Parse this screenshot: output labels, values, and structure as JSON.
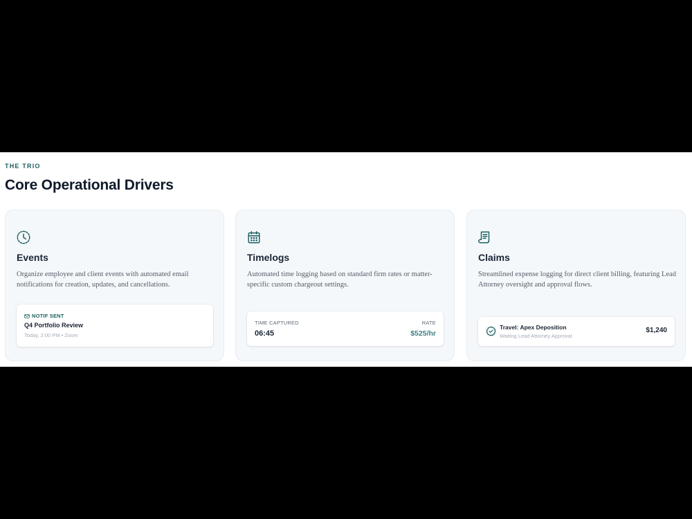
{
  "section": {
    "eyebrow": "THE TRIO",
    "title": "Core Operational Drivers"
  },
  "colors": {
    "accent": "#1a5e5e",
    "rate": "#3e7f84",
    "heading": "#0f1a2a",
    "card_bg": "#f5f8fb"
  },
  "cards": [
    {
      "icon": "clock-icon",
      "title": "Events",
      "description": "Organize employee and client events with automated email notifications for creation, updates, and cancellations.",
      "widget": {
        "tag_icon": "mail-icon",
        "tag": "NOTIF SENT",
        "title": "Q4 Portfolio Review",
        "meta": "Today, 2:00 PM • Zoom"
      }
    },
    {
      "icon": "calendar-icon",
      "title": "Timelogs",
      "description": "Automated time logging based on standard firm rates or matter-specific custom chargeout settings.",
      "widget": {
        "left_label": "TIME CAPTURED",
        "left_value": "06:45",
        "right_label": "RATE",
        "right_value": "$525/hr"
      }
    },
    {
      "icon": "receipt-icon",
      "title": "Claims",
      "description": "Streamlined expense logging for direct client billing, featuring Lead Attorney oversight and approval flows.",
      "widget": {
        "status_icon": "check-badge-icon",
        "title": "Travel: Apex Deposition",
        "subtitle": "Waiting Lead Attorney Approval",
        "amount": "$1,240"
      }
    }
  ]
}
